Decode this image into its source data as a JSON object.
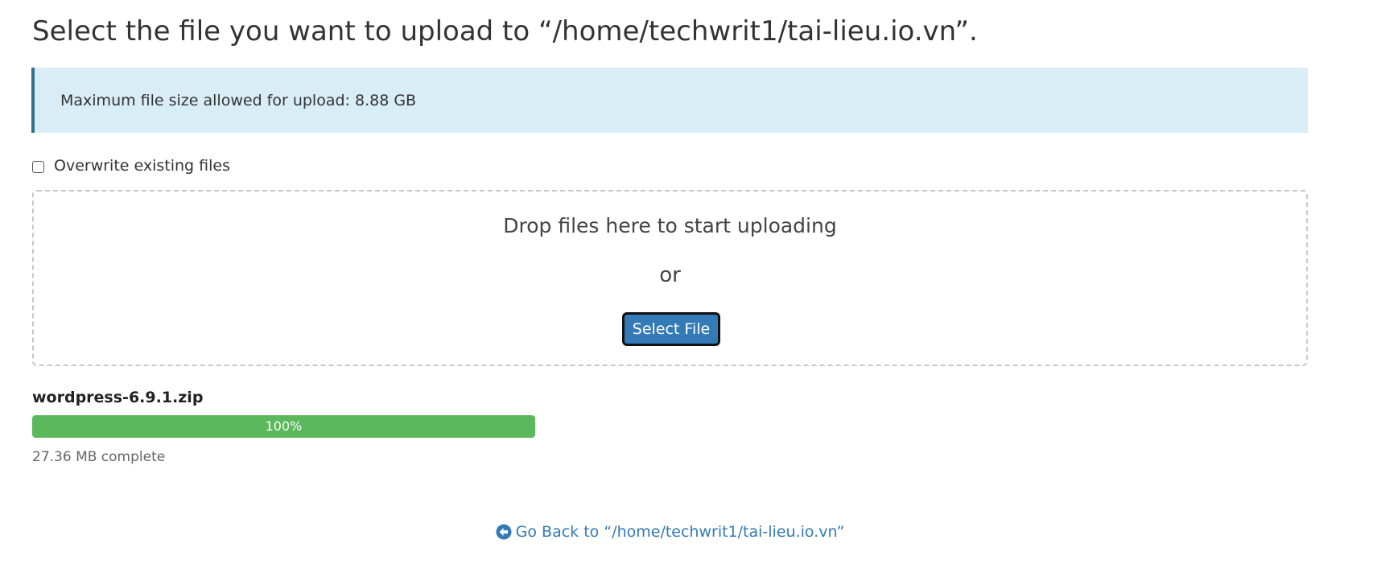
{
  "page": {
    "title": "Select the file you want to upload to “/home/techwrit1/tai-lieu.io.vn”."
  },
  "alert": {
    "text": "Maximum file size allowed for upload: 8.88 GB"
  },
  "options": {
    "overwrite_label": "Overwrite existing files",
    "overwrite_checked": false
  },
  "dropzone": {
    "drop_text": "Drop files here to start uploading",
    "or_text": "or",
    "select_button_label": "Select File"
  },
  "uploads": [
    {
      "file_name": "wordpress-6.9.1.zip",
      "progress_label": "100%",
      "progress_percent": 100,
      "status_text": "27.36 MB complete"
    }
  ],
  "footer": {
    "back_icon": "arrow-circle-left-icon",
    "go_back_label": "Go Back to “/home/techwrit1/tai-lieu.io.vn”"
  },
  "colors": {
    "primary": "#337ab7",
    "alert_bg": "#d9edf7",
    "alert_border": "#31708f",
    "progress": "#5cb85c"
  }
}
